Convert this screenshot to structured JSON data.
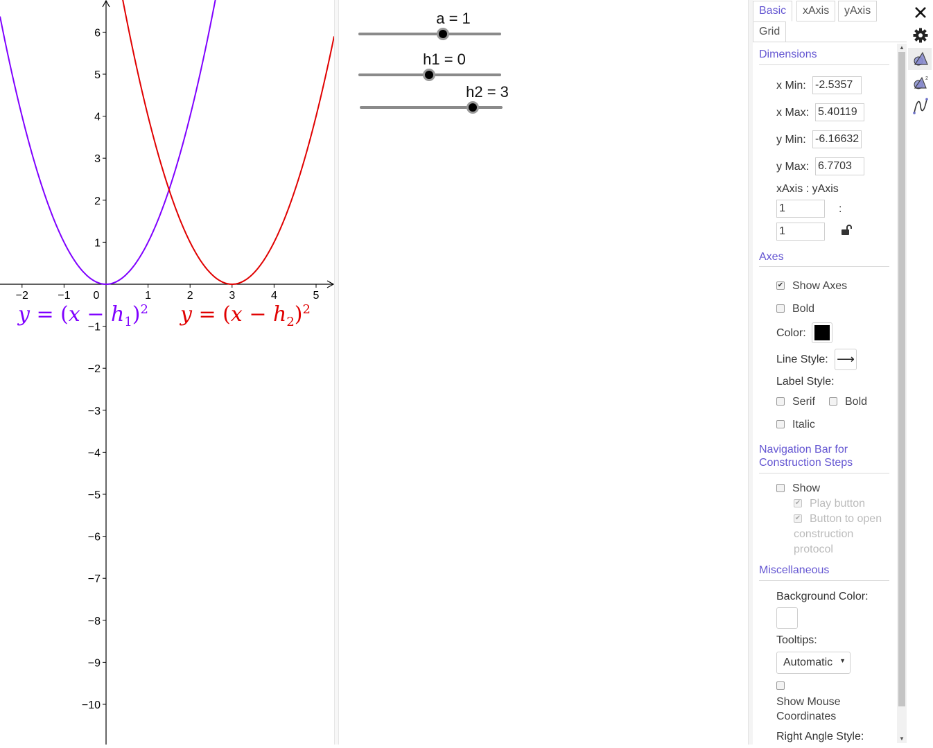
{
  "graphics": {
    "x_ticks": [
      "−2",
      "−1",
      "0",
      "1",
      "2",
      "3",
      "4",
      "5"
    ],
    "y_ticks": [
      "6",
      "5",
      "4",
      "3",
      "2",
      "1",
      "−1",
      "−2",
      "−3",
      "−4",
      "−5",
      "−6",
      "−7",
      "−8",
      "−9",
      "−10"
    ],
    "curve_colors": {
      "f": "#7f00ff",
      "g": "#e00000"
    },
    "label_f": {
      "y": "y",
      "eq": " = (",
      "x": "x",
      "minus": " − ",
      "h": "h",
      "sub": "1",
      "close": ")",
      "sup": "2"
    },
    "label_g": {
      "y": "y",
      "eq": " = (",
      "x": "x",
      "minus": " − ",
      "h": "h",
      "sub": "2",
      "close": ")",
      "sup": "2"
    }
  },
  "sliders": [
    {
      "label": "a = 1",
      "value": 1,
      "min": -5,
      "max": 5
    },
    {
      "label": "h1 = 0",
      "value": 0,
      "min": -5,
      "max": 5
    },
    {
      "label": "h2 = 3",
      "value": 3,
      "min": -5,
      "max": 5
    }
  ],
  "props": {
    "tabs": [
      "Basic",
      "xAxis",
      "yAxis",
      "Grid"
    ],
    "dimensions": {
      "title": "Dimensions",
      "xmin_label": "x Min:",
      "xmin": "-2.5357",
      "xmax_label": "x Max:",
      "xmax": "5.40119",
      "ymin_label": "y Min:",
      "ymin": "-6.16632",
      "ymax_label": "y Max:",
      "ymax": "6.7703",
      "ratio_label": "xAxis : yAxis",
      "ratio_x": "1",
      "ratio_colon": ":",
      "ratio_y": "1"
    },
    "axes": {
      "title": "Axes",
      "show_axes": "Show Axes",
      "bold": "Bold",
      "color_label": "Color:",
      "color": "#000000",
      "line_style_label": "Line Style:",
      "line_style_glyph": "⟶",
      "label_style_label": "Label Style:",
      "serif": "Serif",
      "bold2": "Bold",
      "italic": "Italic"
    },
    "nav": {
      "title_1": "Navigation Bar for",
      "title_2": "Construction Steps",
      "show": "Show",
      "play": "Play button",
      "open_1": "Button to open",
      "open_2": "construction",
      "open_3": "protocol"
    },
    "misc": {
      "title": "Miscellaneous",
      "bg_label": "Background Color:",
      "tooltips_label": "Tooltips:",
      "tooltips_value": "Automatic",
      "mouse_1": "Show Mouse",
      "mouse_2": "Coordinates",
      "right_angle": "Right Angle Style:"
    }
  },
  "rail": [
    "close-icon",
    "settings-gear-icon",
    "graphics-view-icon",
    "graphics-view-2-icon",
    "algebra-curve-icon"
  ],
  "check": "✔"
}
